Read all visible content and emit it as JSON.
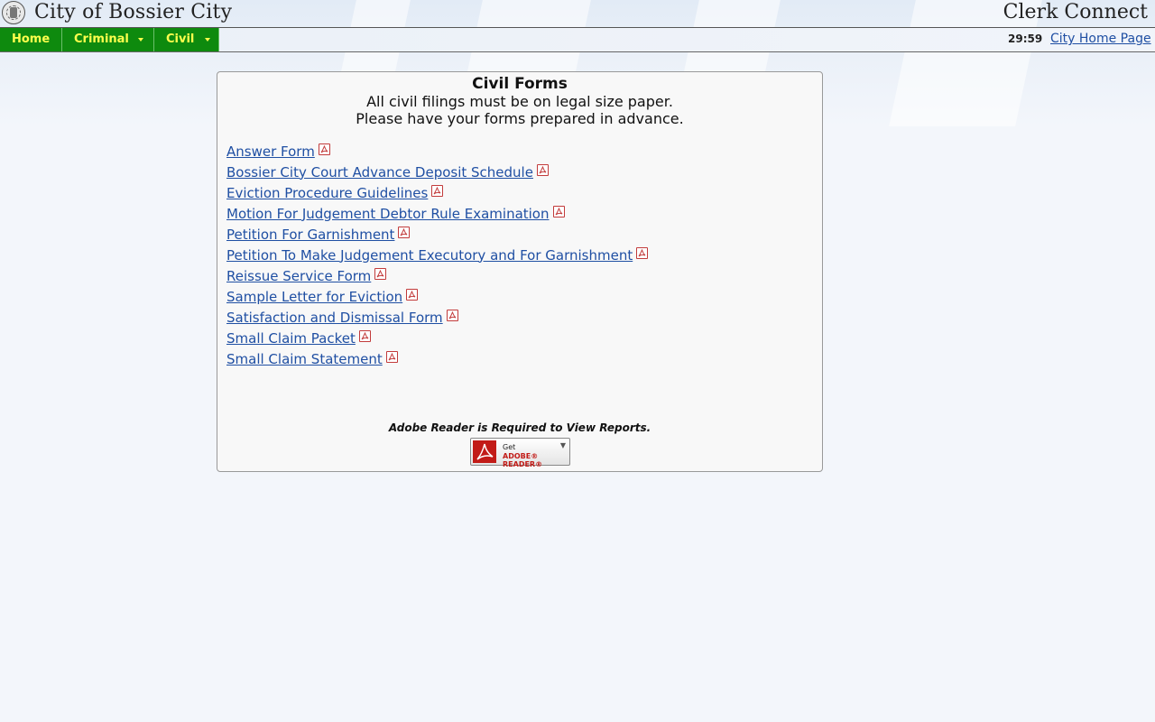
{
  "header": {
    "site_title": "City of Bossier City",
    "app_title": "Clerk Connect",
    "seal_icon": "city-seal-icon"
  },
  "nav": {
    "items": [
      {
        "label": "Home",
        "has_dropdown": false
      },
      {
        "label": "Criminal",
        "has_dropdown": true
      },
      {
        "label": "Civil",
        "has_dropdown": true
      }
    ],
    "timer": "29:59",
    "home_link": "City Home Page"
  },
  "colors": {
    "nav_bg": "#0e8a0e",
    "nav_text": "#ffff4d",
    "link": "#1f4fa3",
    "pdf_red": "#c23b3b"
  },
  "panel": {
    "title": "Civil Forms",
    "subtitle_line1": "All civil filings must be on legal size paper.",
    "subtitle_line2": "Please have your forms prepared in advance.",
    "forms": [
      {
        "label": "Answer Form",
        "icon": "pdf-icon"
      },
      {
        "label": "Bossier City Court Advance Deposit Schedule",
        "icon": "pdf-icon"
      },
      {
        "label": "Eviction Procedure Guidelines",
        "icon": "pdf-icon"
      },
      {
        "label": "Motion For Judgement Debtor Rule Examination",
        "icon": "pdf-icon"
      },
      {
        "label": "Petition For Garnishment",
        "icon": "pdf-icon"
      },
      {
        "label": "Petition To Make Judgement Executory and For Garnishment",
        "icon": "pdf-icon"
      },
      {
        "label": "Reissue Service Form",
        "icon": "pdf-icon"
      },
      {
        "label": "Sample Letter for Eviction",
        "icon": "pdf-icon"
      },
      {
        "label": "Satisfaction and Dismissal Form",
        "icon": "pdf-icon"
      },
      {
        "label": "Small Claim Packet",
        "icon": "pdf-icon"
      },
      {
        "label": "Small Claim Statement",
        "icon": "pdf-icon"
      }
    ],
    "adobe_note": "Adobe Reader is Required to View Reports.",
    "adobe_button": {
      "get": "Get",
      "brand": "ADOBE® READER®",
      "icon": "adobe-reader-icon"
    }
  }
}
